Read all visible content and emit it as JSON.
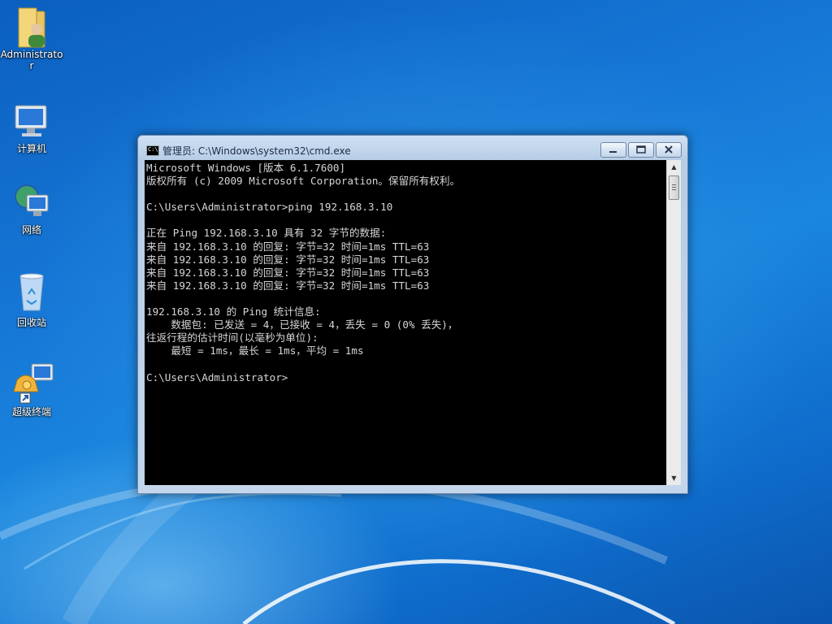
{
  "desktop": {
    "icons": [
      {
        "label": "Administrator",
        "icon": "user-folder-icon"
      },
      {
        "label": "计算机",
        "icon": "computer-icon"
      },
      {
        "label": "网络",
        "icon": "network-icon"
      },
      {
        "label": "回收站",
        "icon": "recycle-bin-icon"
      },
      {
        "label": "超级终端",
        "icon": "hyperterminal-shortcut-icon"
      }
    ]
  },
  "window": {
    "title": "管理员: C:\\Windows\\system32\\cmd.exe",
    "icon_label": "C:\\",
    "buttons": {
      "minimize": "minimize-icon",
      "maximize": "maximize-icon",
      "close": "close-icon"
    }
  },
  "console": {
    "lines": [
      "Microsoft Windows [版本 6.1.7600]",
      "版权所有 (c) 2009 Microsoft Corporation。保留所有权利。",
      "",
      "C:\\Users\\Administrator>ping 192.168.3.10",
      "",
      "正在 Ping 192.168.3.10 具有 32 字节的数据:",
      "来自 192.168.3.10 的回复: 字节=32 时间=1ms TTL=63",
      "来自 192.168.3.10 的回复: 字节=32 时间=1ms TTL=63",
      "来自 192.168.3.10 的回复: 字节=32 时间=1ms TTL=63",
      "来自 192.168.3.10 的回复: 字节=32 时间=1ms TTL=63",
      "",
      "192.168.3.10 的 Ping 统计信息:",
      "    数据包: 已发送 = 4，已接收 = 4，丢失 = 0 (0% 丢失)，",
      "往返行程的估计时间(以毫秒为单位):",
      "    最短 = 1ms，最长 = 1ms，平均 = 1ms",
      "",
      "C:\\Users\\Administrator>"
    ]
  },
  "colors": {
    "console_bg": "#000000",
    "console_fg": "#d6d6d6",
    "desktop_blue": "#1677d6"
  }
}
